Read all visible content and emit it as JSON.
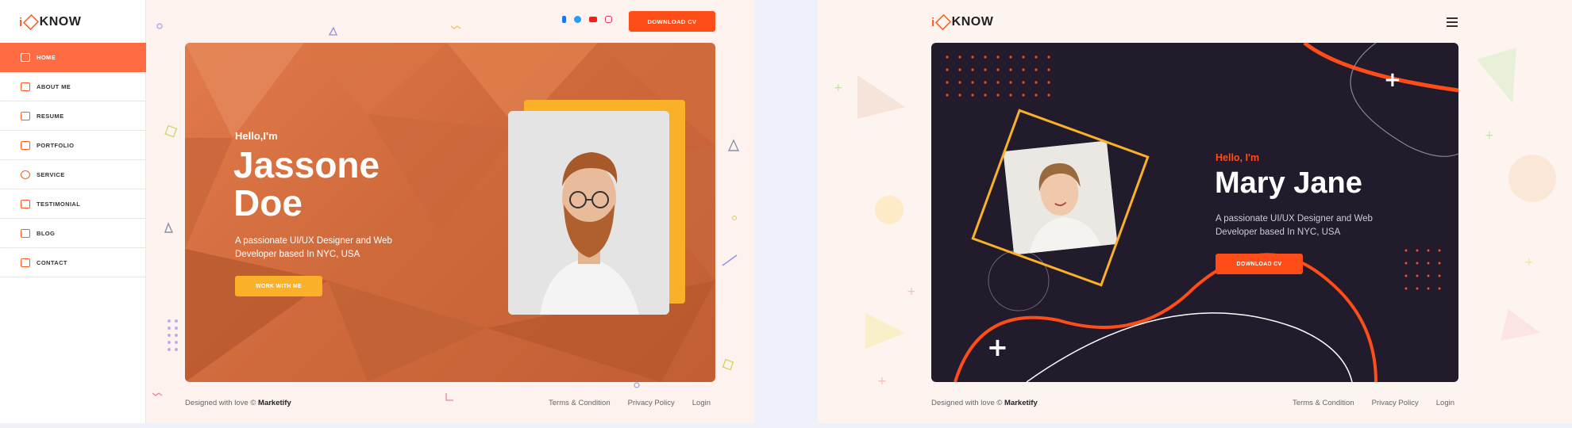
{
  "brand": {
    "logo_text": "KNOW",
    "logo_prefix": "i",
    "accent": "#ff4d1a",
    "yellow": "#fbb02a"
  },
  "left": {
    "nav": [
      {
        "label": "HOME",
        "icon": "home-grid-icon",
        "active": true
      },
      {
        "label": "ABOUT ME",
        "icon": "id-card-icon",
        "active": false
      },
      {
        "label": "RESUME",
        "icon": "document-icon",
        "active": false
      },
      {
        "label": "PORTFOLIO",
        "icon": "briefcase-icon",
        "active": false
      },
      {
        "label": "SERVICE",
        "icon": "gear-icon",
        "active": false
      },
      {
        "label": "TESTIMONIAL",
        "icon": "chat-check-icon",
        "active": false
      },
      {
        "label": "BLOG",
        "icon": "blog-icon",
        "active": false
      },
      {
        "label": "CONTACT",
        "icon": "mail-icon",
        "active": false
      }
    ],
    "social": [
      "facebook-icon",
      "twitter-icon",
      "youtube-icon",
      "instagram-icon"
    ],
    "download_label": "DOWNLOAD CV",
    "hero": {
      "greeting": "Hello,I'm",
      "name_line1": "Jassone",
      "name_line2": "Doe",
      "desc_line1": "A passionate UI/UX Designer and Web",
      "desc_line2": "Developer based In NYC, USA",
      "cta": "WORK WITH ME"
    },
    "footer": {
      "credit_prefix": "Designed with love ©",
      "credit_brand": "Marketify",
      "links": [
        "Terms & Condition",
        "Privacy Policy",
        "Login"
      ]
    }
  },
  "right": {
    "hero": {
      "greeting": "Hello, I'm",
      "name": "Mary Jane",
      "desc_line1": "A passionate UI/UX Designer and Web",
      "desc_line2": "Developer based In NYC, USA",
      "cta": "DOWNLOAD CV"
    },
    "footer": {
      "credit_prefix": "Designed with love ©",
      "credit_brand": "Marketify",
      "links": [
        "Terms & Condition",
        "Privacy Policy",
        "Login"
      ]
    }
  }
}
